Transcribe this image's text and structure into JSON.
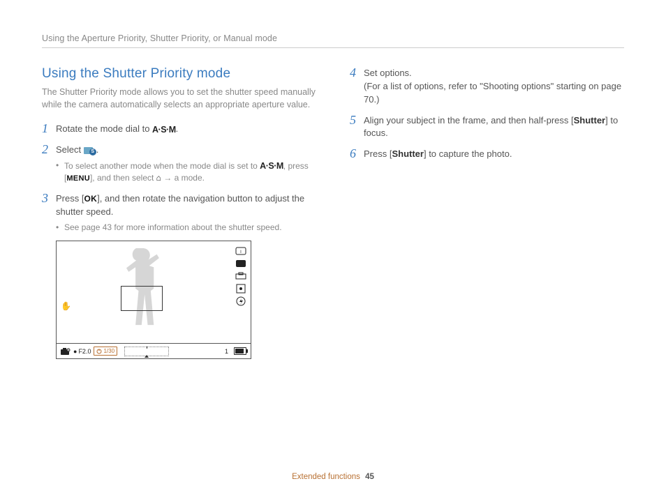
{
  "header": "Using the Aperture Priority, Shutter Priority, or Manual mode",
  "section_title": "Using the Shutter Priority mode",
  "section_intro": "The Shutter Priority mode allows you to set the shutter speed manually while the camera automatically selects an appropriate aperture value.",
  "icons": {
    "asm": "A·S·M",
    "menu": "MENU",
    "ok": "OK",
    "home_arrow": "→",
    "mode_overlay_letter": "S"
  },
  "steps_left": [
    {
      "num": "1",
      "text_pre": "Rotate the mode dial to ",
      "text_post": "."
    },
    {
      "num": "2",
      "text_pre": "Select ",
      "text_post": ".",
      "sub": {
        "pre": "To select another mode when the mode dial is set to ",
        "mid": ", press [",
        "mid2": "], and then select ",
        "post": " a mode."
      }
    },
    {
      "num": "3",
      "text_pre": "Press [",
      "text_post": "], and then rotate the navigation button to adjust the shutter speed.",
      "sub_plain": "See page 43 for more information about the shutter speed."
    }
  ],
  "steps_right": [
    {
      "num": "4",
      "line1": "Set options.",
      "line2": "(For a list of options, refer to \"Shooting options\" starting on page 70.)"
    },
    {
      "num": "5",
      "text_pre": "Align your subject in the frame, and then half-press [",
      "bold": "Shutter",
      "text_post": "] to focus."
    },
    {
      "num": "6",
      "text_pre": "Press [",
      "bold": "Shutter",
      "text_post": "] to capture the photo."
    }
  ],
  "preview_bar": {
    "aperture": "F2.0",
    "shutter": "1/30",
    "shots": "1"
  },
  "footer": {
    "section": "Extended functions",
    "page": "45"
  }
}
